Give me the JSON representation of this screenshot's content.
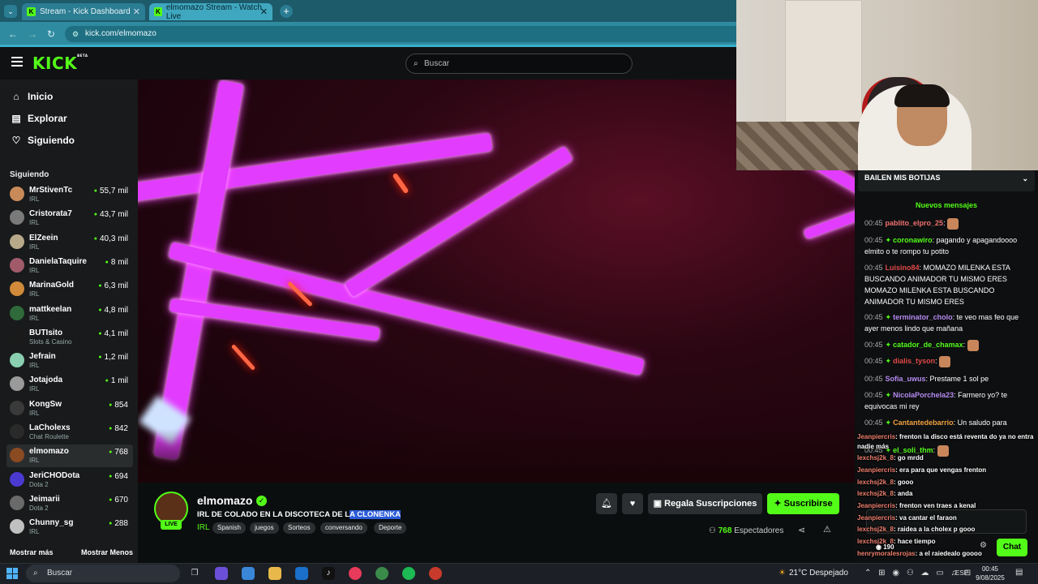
{
  "browser": {
    "tabs": [
      {
        "title": "Stream - Kick Dashboard",
        "favicon": "K"
      },
      {
        "title": "elmomazo Stream - Watch Live",
        "favicon": "K"
      }
    ],
    "url": "kick.com/elmomazo"
  },
  "header": {
    "logo": "KICK",
    "logo_badge": "BETA",
    "search_placeholder": "Buscar"
  },
  "sidebar": {
    "nav": [
      {
        "label": "Inicio",
        "icon": "home-icon"
      },
      {
        "label": "Explorar",
        "icon": "compass-icon"
      },
      {
        "label": "Siguiendo",
        "icon": "heart-icon"
      }
    ],
    "following_header": "Siguiendo",
    "channels": [
      {
        "name": "MrStivenTc",
        "category": "IRL",
        "viewers": "55,7 mil",
        "color": "#c98a5a"
      },
      {
        "name": "Cristorata7",
        "category": "IRL",
        "viewers": "43,7 mil",
        "color": "#7a7a7a"
      },
      {
        "name": "ElZeein",
        "category": "IRL",
        "viewers": "40,3 mil",
        "color": "#b7a98a"
      },
      {
        "name": "DanielaTaquire",
        "category": "IRL",
        "viewers": "8 mil",
        "color": "#a05a6a"
      },
      {
        "name": "MarinaGold",
        "category": "IRL",
        "viewers": "6,3 mil",
        "color": "#d08a3a"
      },
      {
        "name": "mattkeelan",
        "category": "IRL",
        "viewers": "4,8 mil",
        "color": "#2f6a3a"
      },
      {
        "name": "BUTIsito",
        "category": "Slots & Casino",
        "viewers": "4,1 mil",
        "color": "#1a1a1a"
      },
      {
        "name": "Jefrain",
        "category": "IRL",
        "viewers": "1,2 mil",
        "color": "#8ad0b0"
      },
      {
        "name": "Jotajoda",
        "category": "IRL",
        "viewers": "1 mil",
        "color": "#9a9a9a"
      },
      {
        "name": "KongSw",
        "category": "IRL",
        "viewers": "854",
        "color": "#3a3a3a"
      },
      {
        "name": "LaCholexs",
        "category": "Chat Roulette",
        "viewers": "842",
        "color": "#2a2a2a"
      },
      {
        "name": "elmomazo",
        "category": "IRL",
        "viewers": "768",
        "color": "#8a4a22"
      },
      {
        "name": "JeriCHODota",
        "category": "Dota 2",
        "viewers": "694",
        "color": "#4a3ad0"
      },
      {
        "name": "Jeimarii",
        "category": "Dota 2",
        "viewers": "670",
        "color": "#6a6a6a"
      },
      {
        "name": "Chunny_sg",
        "category": "IRL",
        "viewers": "288",
        "color": "#c0c0c0"
      }
    ],
    "show_more": "Mostrar más",
    "show_less": "Mostrar Menos"
  },
  "stream": {
    "streamer": "elmomazo",
    "live_label": "LIVE",
    "title_prefix": "IRL DE COLADO EN LA DISCOTECA DE L",
    "title_highlight": "A CLONENKA",
    "category": "IRL",
    "tags": [
      "Spanish",
      "juegos",
      "Sorteos",
      "conversando",
      "Deporte"
    ],
    "gift_label": "Regala Suscripciones",
    "subscribe_label": "Suscribirse",
    "viewers": "768",
    "viewers_label": "Espectadores"
  },
  "chat": {
    "pinned": "BAILEN MIS BOTIJAS",
    "new_messages": "Nuevos mensajes",
    "messages": [
      {
        "time": "00:45",
        "user": "pablito_elpro_25",
        "color": "#f07070",
        "text": ":",
        "badge": false
      },
      {
        "time": "00:45",
        "user": "coronawiro",
        "color": "#53fc18",
        "text": ": pagando y apagandoooo elmito o te rompo tu potito",
        "badge": true
      },
      {
        "time": "00:45",
        "user": "Luisino84",
        "color": "#e04848",
        "text": ": MOMAZO MILENKA ESTA BUSCANDO ANIMADOR TU MISMO ERES MOMAZO MILENKA ESTA BUSCANDO ANIMADOR TU MISMO ERES",
        "badge": false
      },
      {
        "time": "00:45",
        "user": "terminator_cholo",
        "color": "#b58af0",
        "text": ": te veo mas feo que ayer menos lindo que mañana",
        "badge": true
      },
      {
        "time": "00:45",
        "user": "catador_de_chamax",
        "color": "#53fc18",
        "text": ":",
        "badge": true
      },
      {
        "time": "00:45",
        "user": "dialis_tyson",
        "color": "#e04848",
        "text": ":",
        "badge": true
      },
      {
        "time": "00:45",
        "user": "Sofia_uwus",
        "color": "#b58af0",
        "text": ": Prestame 1 sol pe",
        "badge": false
      },
      {
        "time": "00:45",
        "user": "NicolaPorchela23",
        "color": "#b58af0",
        "text": ": Farmero yo? te equivocas mi rey",
        "badge": true
      },
      {
        "time": "00:45",
        "user": "Cantantedebarrio",
        "color": "#f0a040",
        "text": ": Un saludo para",
        "badge": true
      },
      {
        "time": "00:45",
        "user": "el_soli_thm",
        "color": "#53fc18",
        "text": ":",
        "badge": true
      }
    ],
    "overlay": [
      {
        "user": "Jeanpiercris",
        "text": ": frenton la disco está reventa do ya no entra nadie más"
      },
      {
        "user": "lexchsj2k_8",
        "text": ": go mrdd"
      },
      {
        "user": "Jeanpiercris",
        "text": ": era para que vengas frenton"
      },
      {
        "user": "lexchsj2k_8",
        "text": ": gooo"
      },
      {
        "user": "lexchsj2k_8",
        "text": ": anda"
      },
      {
        "user": "Jeanpiercris",
        "text": ": frenton ven traes a kenal"
      },
      {
        "user": "Jeanpiercris",
        "text": ": va cantar el faraon"
      },
      {
        "user": "lexchsj2k_8",
        "text": ": raidea a la cholex p gooo"
      },
      {
        "user": "lexchsj2k_8",
        "text": ": hace tiempo"
      },
      {
        "user": "henrymoralesrojas",
        "text": ": a el raiedealo goooo"
      }
    ],
    "points": "190",
    "chat_button": "Chat"
  },
  "taskbar": {
    "search_placeholder": "Buscar",
    "weather": "21°C  Despejado",
    "lang": "ESP",
    "time": "00:45",
    "date": "9/08/2025"
  }
}
